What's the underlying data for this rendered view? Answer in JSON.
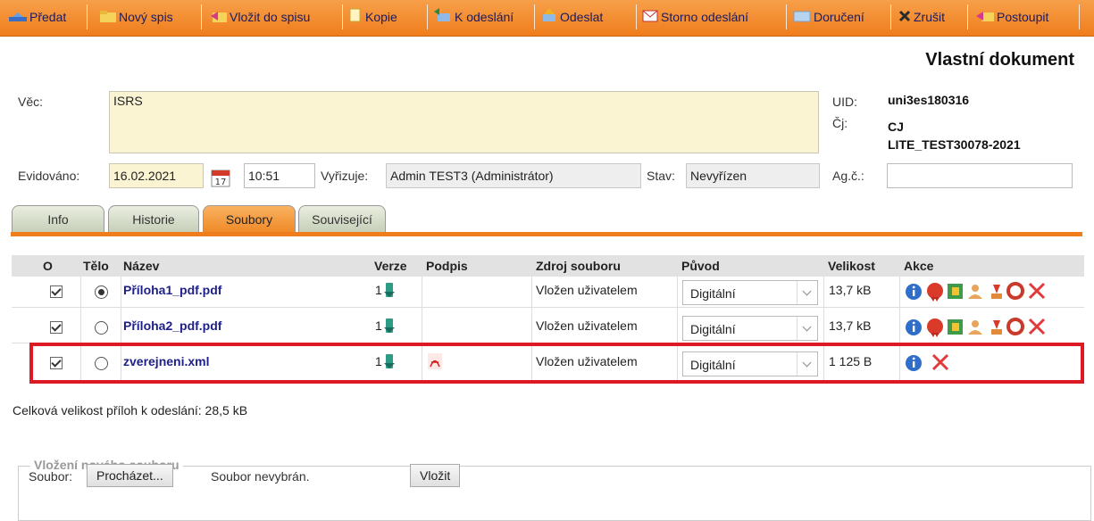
{
  "toolbar": {
    "items": [
      "Předat",
      "Nový spis",
      "Vložit do spisu",
      "Kopie",
      "K odeslání",
      "Odeslat",
      "Storno odeslání",
      "Doručení",
      "Zrušit",
      "Postoupit"
    ]
  },
  "doc_title": "Vlastní dokument",
  "form": {
    "vec_label": "Věc:",
    "vec_value": "ISRS",
    "uid_label": "UID:",
    "uid_value": "uni3es180316",
    "cj_label": "Čj:",
    "cj_value_1": "CJ",
    "cj_value_2": "LITE_TEST30078-2021",
    "evidovano_label": "Evidováno:",
    "date": "16.02.2021",
    "calendar_day": "17",
    "time": "10:51",
    "vyrizuje_label": "Vyřizuje:",
    "vyrizuje_value": "Admin TEST3 (Administrátor)",
    "stav_label": "Stav:",
    "stav_value": "Nevyřízen",
    "agc_label": "Ag.č.:",
    "agc_value": ""
  },
  "tabs": [
    "Info",
    "Historie",
    "Soubory",
    "Související"
  ],
  "active_tab": "Soubory",
  "table": {
    "headers": [
      "O",
      "Tělo",
      "Název",
      "Verze",
      "Podpis",
      "Zdroj souboru",
      "Původ",
      "Velikost",
      "Akce"
    ],
    "rows": [
      {
        "name": "Příloha1_pdf.pdf",
        "version": "1",
        "source": "Vložen uživatelem",
        "origin": "Digitální",
        "size": "13,7 kB",
        "body_selected": true
      },
      {
        "name": "Příloha2_pdf.pdf",
        "version": "1",
        "source": "Vložen uživatelem",
        "origin": "Digitální",
        "size": "13,7 kB",
        "body_selected": false
      },
      {
        "name": "zverejneni.xml",
        "version": "1",
        "source": "Vložen uživatelem",
        "origin": "Digitální",
        "size": "1 125 B",
        "body_selected": false
      }
    ]
  },
  "total_size_text": "Celková velikost příloh k odeslání: 28,5 kB",
  "upload": {
    "legend": "Vložení nového souboru",
    "file_label": "Soubor:",
    "browse_button": "Procházet...",
    "no_file_text": "Soubor nevybrán.",
    "insert_button": "Vložit"
  },
  "colors": {
    "accent": "#ef7d1c",
    "highlight": "#dd1a24",
    "link": "#1f1f8a"
  }
}
